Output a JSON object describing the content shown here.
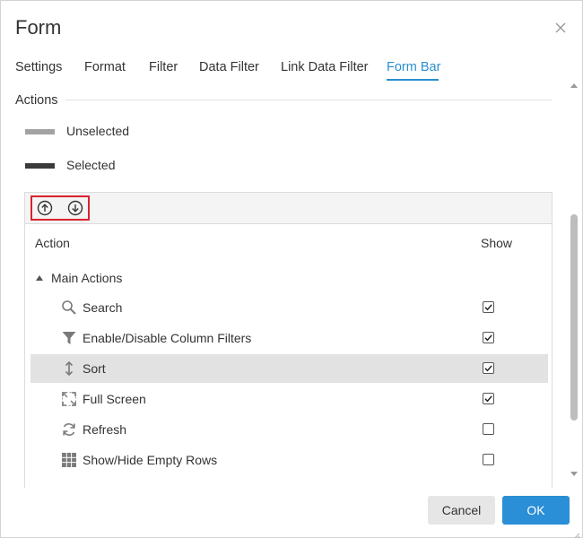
{
  "dialog": {
    "title": "Form",
    "close_icon": "close-icon"
  },
  "tabs": [
    {
      "label": "Settings",
      "active": false
    },
    {
      "label": "Format",
      "active": false
    },
    {
      "label": "Filter",
      "active": false
    },
    {
      "label": "Data Filter",
      "active": false
    },
    {
      "label": "Link Data Filter",
      "active": false
    },
    {
      "label": "Form Bar",
      "active": true
    }
  ],
  "section": {
    "title": "Actions"
  },
  "legend": [
    {
      "label": "Unselected",
      "color": "#a3a3a3"
    },
    {
      "label": "Selected",
      "color": "#3a3a3a"
    }
  ],
  "toolbar": {
    "move_up_icon": "move-up-icon",
    "move_down_icon": "move-down-icon"
  },
  "table": {
    "columns": {
      "action": "Action",
      "show": "Show"
    },
    "group": {
      "label": "Main Actions",
      "expanded": true
    },
    "rows": [
      {
        "label": "Search",
        "icon": "search-icon",
        "checked": true,
        "selected": false
      },
      {
        "label": "Enable/Disable Column Filters",
        "icon": "filter-icon",
        "checked": true,
        "selected": false
      },
      {
        "label": "Sort",
        "icon": "sort-icon",
        "checked": true,
        "selected": true
      },
      {
        "label": "Full Screen",
        "icon": "full-screen-icon",
        "checked": true,
        "selected": false
      },
      {
        "label": "Refresh",
        "icon": "refresh-icon",
        "checked": false,
        "selected": false
      },
      {
        "label": "Show/Hide Empty Rows",
        "icon": "grid-icon",
        "checked": false,
        "selected": false
      }
    ]
  },
  "buttons": {
    "cancel": "Cancel",
    "ok": "OK"
  },
  "colors": {
    "accent": "#2a8fcf",
    "ok_button": "#2a8fd6",
    "highlight_border": "#d9232e",
    "selected_row": "#e2e2e2"
  }
}
